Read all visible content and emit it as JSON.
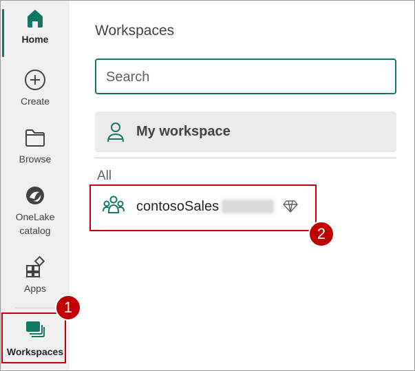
{
  "nav": {
    "items": [
      {
        "label": "Home"
      },
      {
        "label": "Create"
      },
      {
        "label": "Browse"
      },
      {
        "label": "OneLake\ncatalog"
      },
      {
        "label": "Apps"
      },
      {
        "label": "Workspaces"
      }
    ]
  },
  "panel": {
    "title": "Workspaces",
    "search": {
      "placeholder": "Search",
      "value": ""
    },
    "my_workspace": {
      "label": "My workspace"
    },
    "section_label": "All",
    "workspaces": [
      {
        "name": "contosoSales",
        "icon": "group-icon",
        "badge_icon": "diamond-icon"
      }
    ]
  },
  "callouts": [
    "1",
    "2"
  ],
  "colors": {
    "accent": "#117865",
    "highlight": "#c00000",
    "rail_bg": "#f0f0f0"
  }
}
